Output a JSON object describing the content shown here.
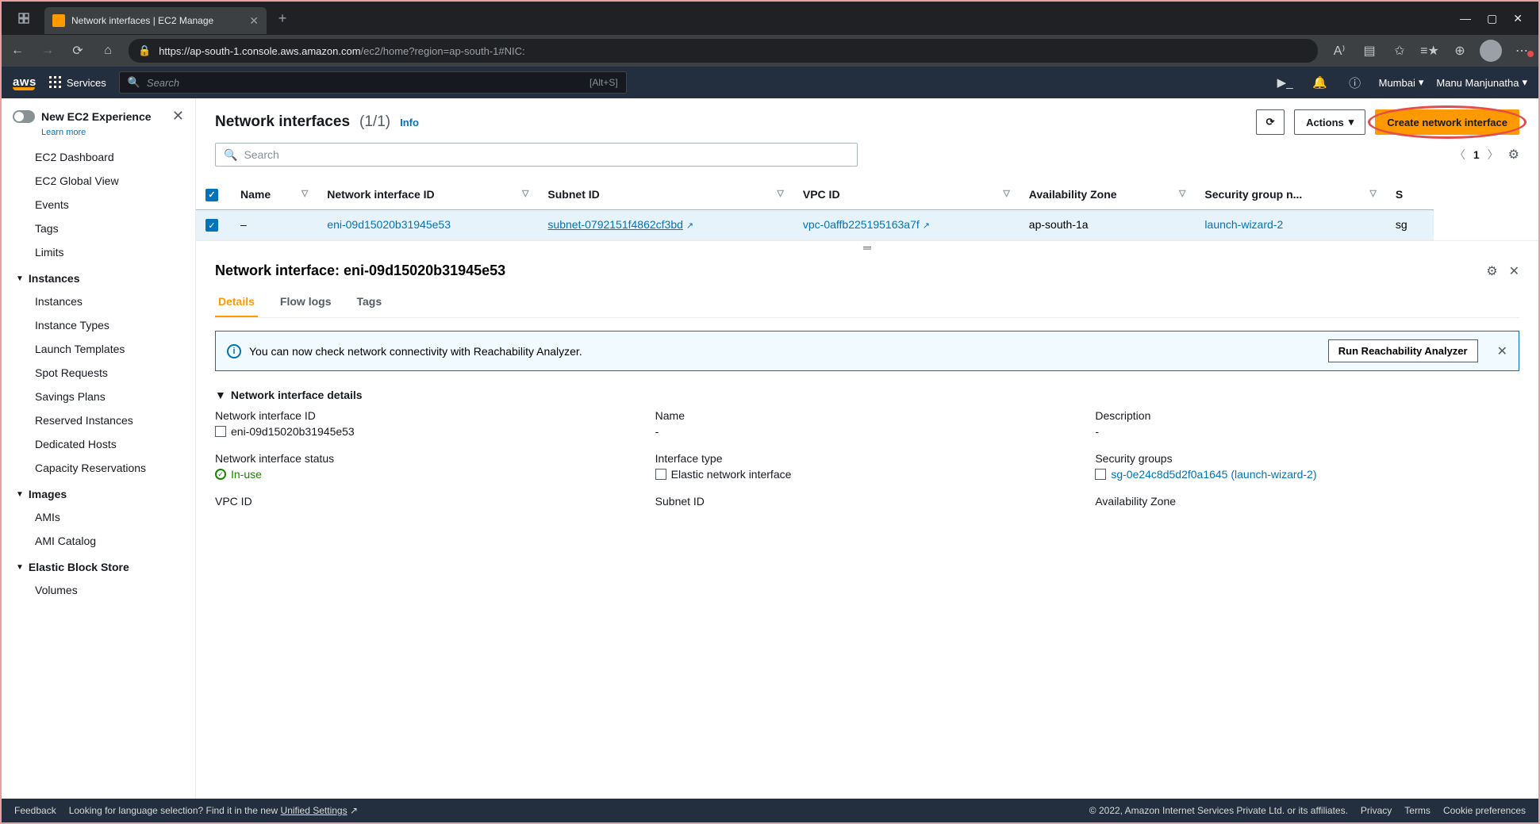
{
  "browser": {
    "tab_title": "Network interfaces | EC2 Manage",
    "url_host": "https://ap-south-1.console.aws.amazon.com",
    "url_path": "/ec2/home?region=ap-south-1#NIC:"
  },
  "awsbar": {
    "services": "Services",
    "search_placeholder": "Search",
    "search_shortcut": "[Alt+S]",
    "region": "Mumbai",
    "user": "Manu Manjunatha"
  },
  "sidebar": {
    "new_exp": "New EC2 Experience",
    "learn": "Learn more",
    "top": [
      "EC2 Dashboard",
      "EC2 Global View",
      "Events",
      "Tags",
      "Limits"
    ],
    "groups": [
      {
        "title": "Instances",
        "items": [
          "Instances",
          "Instance Types",
          "Launch Templates",
          "Spot Requests",
          "Savings Plans",
          "Reserved Instances",
          "Dedicated Hosts",
          "Capacity Reservations"
        ]
      },
      {
        "title": "Images",
        "items": [
          "AMIs",
          "AMI Catalog"
        ]
      },
      {
        "title": "Elastic Block Store",
        "items": [
          "Volumes"
        ]
      }
    ]
  },
  "header": {
    "title": "Network interfaces",
    "count": "(1/1)",
    "info": "Info",
    "actions": "Actions",
    "create": "Create network interface",
    "search_placeholder": "Search",
    "page": "1"
  },
  "table": {
    "cols": [
      "Name",
      "Network interface ID",
      "Subnet ID",
      "VPC ID",
      "Availability Zone",
      "Security group n...",
      "S"
    ],
    "row": {
      "name": "–",
      "eni": "eni-09d15020b31945e53",
      "subnet": "subnet-0792151f4862cf3bd",
      "vpc": "vpc-0affb225195163a7f",
      "az": "ap-south-1a",
      "sg": "launch-wizard-2",
      "tail": "sg"
    }
  },
  "detail": {
    "title": "Network interface: eni-09d15020b31945e53",
    "tabs": [
      "Details",
      "Flow logs",
      "Tags"
    ],
    "alert_text": "You can now check network connectivity with Reachability Analyzer.",
    "alert_btn": "Run Reachability Analyzer",
    "section": "Network interface details",
    "fields": {
      "ni_id_lbl": "Network interface ID",
      "ni_id": "eni-09d15020b31945e53",
      "name_lbl": "Name",
      "name": "-",
      "desc_lbl": "Description",
      "desc": "-",
      "status_lbl": "Network interface status",
      "status": "In-use",
      "itype_lbl": "Interface type",
      "itype": "Elastic network interface",
      "sg_lbl": "Security groups",
      "sg": "sg-0e24c8d5d2f0a1645 (launch-wizard-2)",
      "vpc_lbl": "VPC ID",
      "subnet_lbl": "Subnet ID",
      "az_lbl": "Availability Zone"
    }
  },
  "footer": {
    "feedback": "Feedback",
    "lang": "Looking for language selection? Find it in the new ",
    "unified": "Unified Settings",
    "copyright": "© 2022, Amazon Internet Services Private Ltd. or its affiliates.",
    "privacy": "Privacy",
    "terms": "Terms",
    "cookie": "Cookie preferences"
  }
}
